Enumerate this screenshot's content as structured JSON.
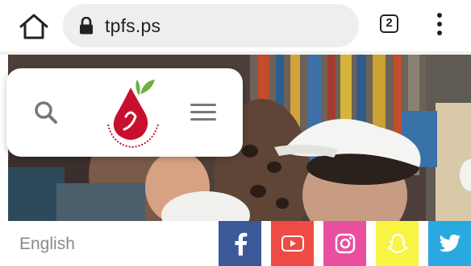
{
  "browser": {
    "url": "tpfs.ps",
    "tab_count": "2",
    "icons": [
      "home-icon",
      "lock-icon",
      "tab-switcher-icon",
      "more-vert-icon"
    ]
  },
  "header": {
    "icons": [
      "search-icon",
      "logo",
      "hamburger-menu-icon"
    ]
  },
  "footer": {
    "language_link": "English",
    "social": [
      {
        "name": "facebook",
        "color": "#3b5998"
      },
      {
        "name": "youtube",
        "color": "#ef4b44"
      },
      {
        "name": "instagram",
        "color": "#e84f9e"
      },
      {
        "name": "snapchat",
        "color": "#f7f443"
      },
      {
        "name": "twitter",
        "color": "#2aa9e0"
      }
    ]
  },
  "colors": {
    "logo_red": "#c8102e",
    "logo_green": "#6ab23e"
  }
}
